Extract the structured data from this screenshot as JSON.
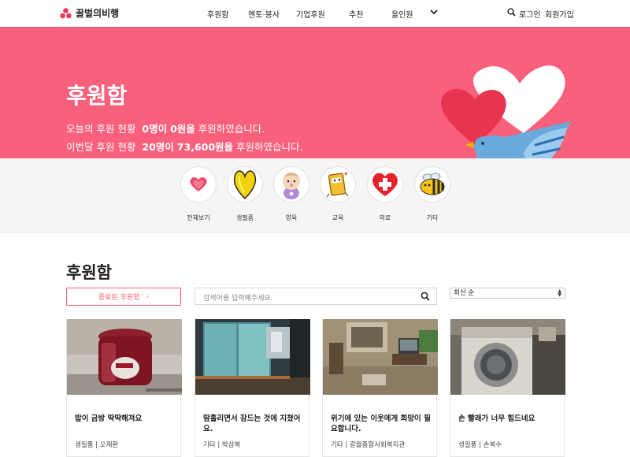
{
  "header": {
    "logo_text": "꿀벌의비행",
    "nav": [
      "후원함",
      "멘토·봉사",
      "기업후원",
      "추천",
      "올인원"
    ],
    "login": "로그인",
    "signup": "회원가입"
  },
  "hero": {
    "title": "후원함",
    "line1_prefix": "오늘의 후원 현황",
    "line1_people": "0명이",
    "line1_amount": "0원을",
    "line1_suffix": "후원하였습니다.",
    "line2_prefix": "이번달 후원 현황",
    "line2_people": "20명이",
    "line2_amount": "73,600원을",
    "line2_suffix": "후원하였습니다."
  },
  "categories": [
    "전체보기",
    "생필품",
    "양육",
    "교육",
    "의료",
    "기타"
  ],
  "section": {
    "title": "후원함",
    "closed_button": "종료된 후원함",
    "search_placeholder": "검색어를 입력해주세요.",
    "sort_selected": "최신 순"
  },
  "cards": [
    {
      "title": "밥이 금방 딱딱해져요",
      "category": "생필품",
      "author": "오재환"
    },
    {
      "title": "땀흘리면서 잠드는 것에 지쳤어요.",
      "category": "기타",
      "author": "박삼복"
    },
    {
      "title": "위기에 있는 이웃에게 희망이 필요합니다.",
      "category": "기타",
      "author": "갈월종합사회복지관"
    },
    {
      "title": "손 빨래가 너무 힘드네요",
      "category": "생필품",
      "author": "손복수"
    }
  ],
  "colors": {
    "brand": "#f9607b",
    "accent": "#ea3b5d"
  }
}
